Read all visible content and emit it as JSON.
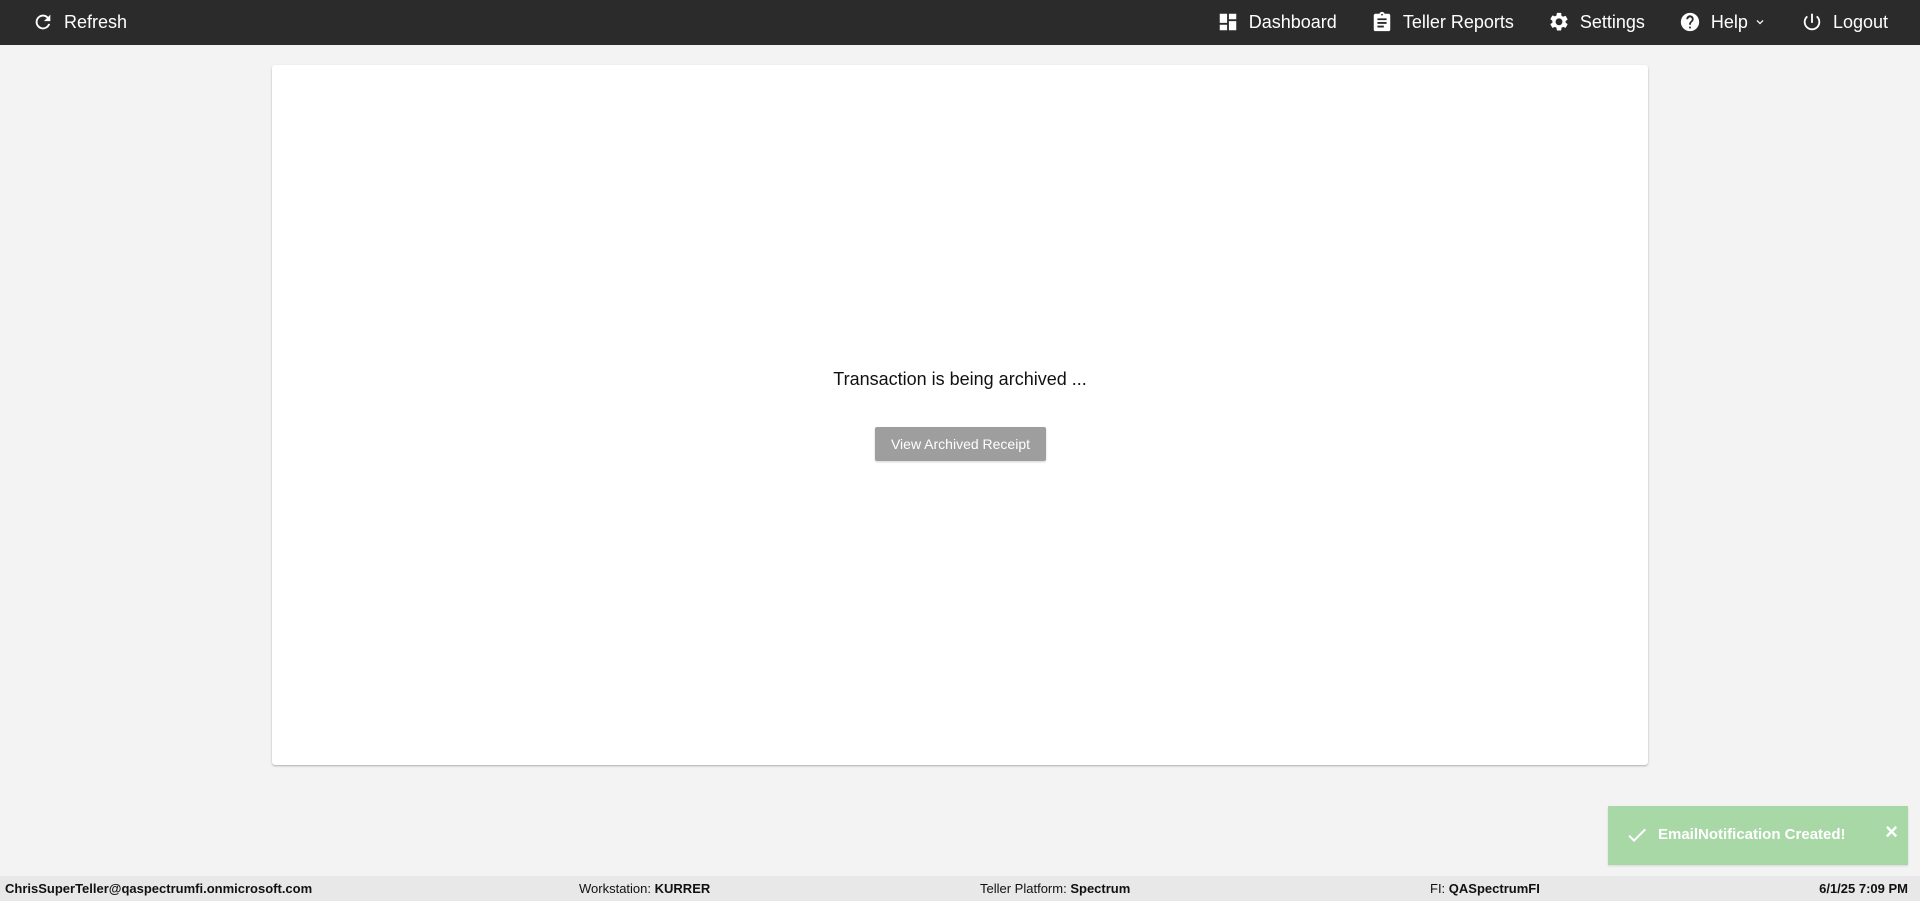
{
  "topbar": {
    "refresh_label": "Refresh",
    "dashboard_label": "Dashboard",
    "reports_label": "Teller Reports",
    "settings_label": "Settings",
    "help_label": "Help",
    "logout_label": "Logout"
  },
  "main": {
    "status_message": "Transaction is being archived ...",
    "view_receipt_label": "View Archived Receipt"
  },
  "toast": {
    "message": "EmailNotification Created!",
    "close_label": "×",
    "background_color": "#a8d8a6"
  },
  "footer": {
    "user": "ChrisSuperTeller@qaspectrumfi.onmicrosoft.com",
    "workstation_label": "Workstation:",
    "workstation_value": "KURRER",
    "platform_label": "Teller Platform:",
    "platform_value": "Spectrum",
    "fi_label": "FI:",
    "fi_value": "QASpectrumFI",
    "datetime": "6/1/25 7:09 PM"
  },
  "icons": {
    "refresh": "refresh-icon",
    "dashboard": "dashboard-icon",
    "reports": "clipboard-icon",
    "settings": "gear-icon",
    "help": "question-circle-icon",
    "help_menu": "chevron-down-icon",
    "logout": "power-icon",
    "toast_success": "check-icon",
    "toast_close": "close-icon"
  },
  "colors": {
    "header": "#2b2b2b",
    "page_background": "#f3f3f3",
    "button": "#9e9e9e",
    "footer": "#e8e8e8"
  }
}
